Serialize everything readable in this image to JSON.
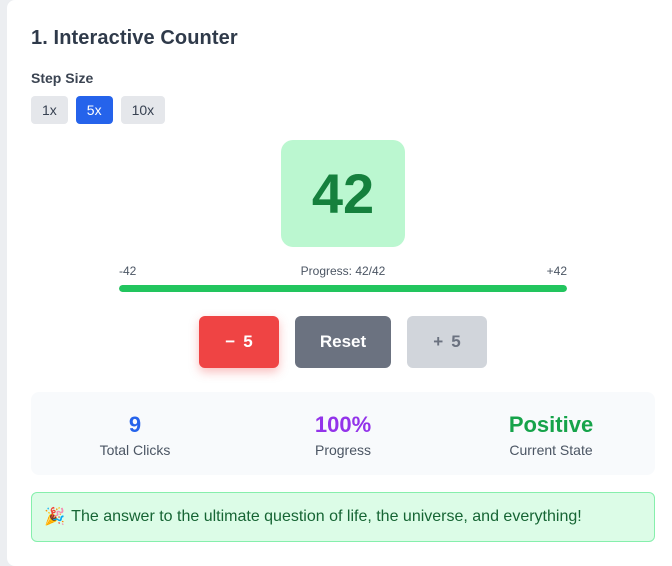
{
  "section": {
    "title": "1. Interactive Counter"
  },
  "step": {
    "label": "Step Size",
    "options": [
      "1x",
      "5x",
      "10x"
    ],
    "selected": "5x"
  },
  "counter": {
    "value": "42",
    "min_label": "-42",
    "max_label": "+42",
    "progress_label": "Progress: 42/42",
    "progress_fraction": 1.0
  },
  "controls": {
    "decrement_symbol": "−",
    "decrement_amount": "5",
    "reset_label": "Reset",
    "increment_symbol": "+",
    "increment_amount": "5"
  },
  "stats": [
    {
      "value": "9",
      "label": "Total Clicks",
      "color": "#2563eb"
    },
    {
      "value": "100%",
      "label": "Progress",
      "color": "#9333ea"
    },
    {
      "value": "Positive",
      "label": "Current State",
      "color": "#16a34a"
    }
  ],
  "banner": {
    "icon": "party-popper-icon",
    "text": "The answer to the ultimate question of life, the universe, and everything!"
  }
}
